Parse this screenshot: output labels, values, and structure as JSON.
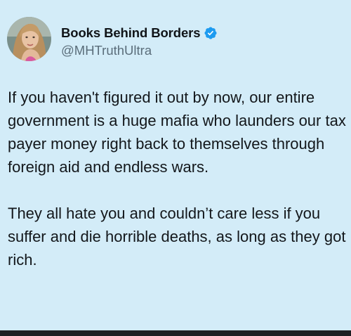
{
  "tweet": {
    "author": {
      "display_name": "Books Behind Borders",
      "handle": "@MHTruthUltra",
      "verified_icon": "verified-badge-icon",
      "avatar_icon": "profile-photo"
    },
    "paragraphs": [
      "If you haven't figured it out by now, our entire government is a huge mafia who launders our tax payer money right back to themselves through foreign aid and endless wars.",
      "They all hate you and couldn’t care less if you suffer and die horrible deaths, as long as they got rich."
    ]
  },
  "colors": {
    "background": "#d3ecf8",
    "text": "#13171b",
    "handle": "#5b6e7b",
    "verified": "#1d9bf0",
    "bottom_bar": "#1c1e21"
  }
}
